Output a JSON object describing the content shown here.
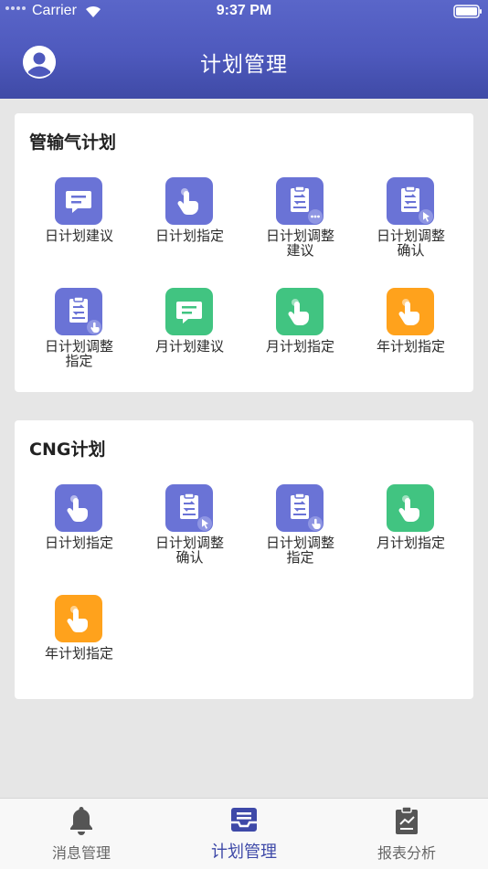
{
  "status_bar": {
    "carrier": "Carrier",
    "time": "9:37 PM"
  },
  "header": {
    "title": "计划管理",
    "avatar_icon": "user-circle-icon"
  },
  "colors": {
    "header": "#4e59bd",
    "blue_tile": "#6a73d6",
    "green_tile": "#41c481",
    "orange_tile": "#ffa21c",
    "active_tab": "#3e49a8"
  },
  "sections": [
    {
      "title": "管输气计划",
      "items": [
        {
          "line1": "日计划建议",
          "line2": "",
          "icon": "chat-icon",
          "color": "blue"
        },
        {
          "line1": "日计划指定",
          "line2": "",
          "icon": "tap-icon",
          "color": "blue"
        },
        {
          "line1": "日计划调整",
          "line2": "建议",
          "icon": "clipboard-chat-icon",
          "color": "blue"
        },
        {
          "line1": "日计划调整",
          "line2": "确认",
          "icon": "clipboard-cursor-icon",
          "color": "blue"
        },
        {
          "line1": "日计划调整",
          "line2": "指定",
          "icon": "clipboard-tap-icon",
          "color": "blue"
        },
        {
          "line1": "月计划建议",
          "line2": "",
          "icon": "chat-icon",
          "color": "green"
        },
        {
          "line1": "月计划指定",
          "line2": "",
          "icon": "tap-icon",
          "color": "green"
        },
        {
          "line1": "年计划指定",
          "line2": "",
          "icon": "tap-icon",
          "color": "orange"
        }
      ]
    },
    {
      "title": "CNG计划",
      "items": [
        {
          "line1": "日计划指定",
          "line2": "",
          "icon": "tap-icon",
          "color": "blue"
        },
        {
          "line1": "日计划调整",
          "line2": "确认",
          "icon": "clipboard-cursor-icon",
          "color": "blue"
        },
        {
          "line1": "日计划调整",
          "line2": "指定",
          "icon": "clipboard-tap-icon",
          "color": "blue"
        },
        {
          "line1": "月计划指定",
          "line2": "",
          "icon": "tap-icon",
          "color": "green"
        },
        {
          "line1": "年计划指定",
          "line2": "",
          "icon": "tap-icon",
          "color": "orange"
        }
      ]
    }
  ],
  "tabs": [
    {
      "label": "消息管理",
      "icon": "bell-icon"
    },
    {
      "label": "计划管理",
      "icon": "inbox-icon",
      "active": true
    },
    {
      "label": "报表分析",
      "icon": "report-icon"
    }
  ]
}
